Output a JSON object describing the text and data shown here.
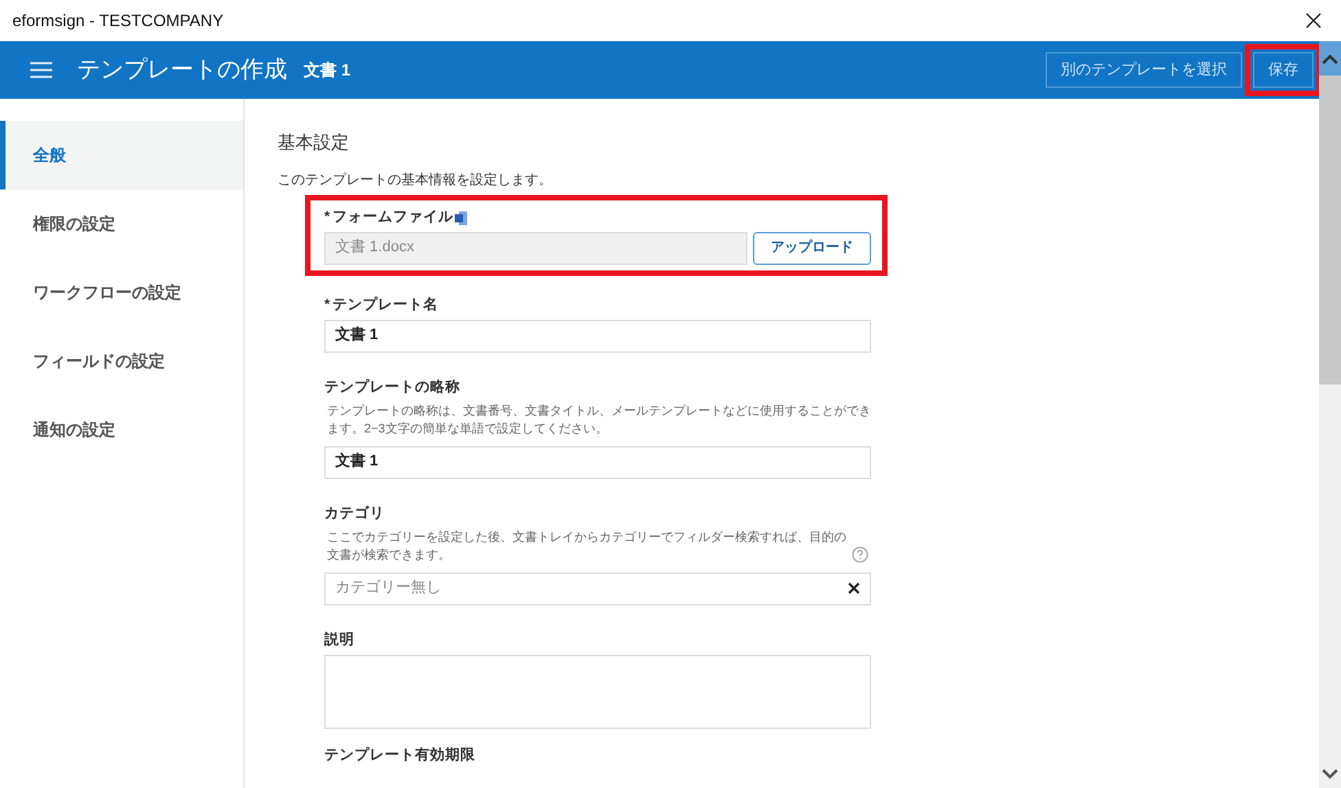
{
  "window": {
    "title": "eformsign - TESTCOMPANY"
  },
  "header": {
    "title": "テンプレートの作成",
    "document": "文書 1",
    "buttons": [
      {
        "label": "別のテンプレートを選択",
        "highlighted": false
      },
      {
        "label": "保存",
        "highlighted": true
      }
    ]
  },
  "sidebar": {
    "items": [
      {
        "label": "全般",
        "selected": true
      },
      {
        "label": "権限の設定",
        "selected": false
      },
      {
        "label": "ワークフローの設定",
        "selected": false
      },
      {
        "label": "フィールドの設定",
        "selected": false
      },
      {
        "label": "通知の設定",
        "selected": false
      }
    ]
  },
  "section": {
    "title": "基本設定",
    "description": "このテンプレートの基本情報を設定します。"
  },
  "fields": [
    {
      "kind": "file",
      "marker": "*",
      "label": "フォームファイル",
      "value": "文書 1.docx",
      "button": "アップロード",
      "highlighted": true
    },
    {
      "kind": "text",
      "marker": "*",
      "label": "テンプレート名",
      "value": "文書 1"
    },
    {
      "kind": "text",
      "label": "テンプレートの略称",
      "help": "テンプレートの略称は、文書番号、文書タイトル、メールテンプレートなどに使用することができます。2−3文字の簡単な単語で設定してください。",
      "value": "文書 1"
    },
    {
      "kind": "select",
      "label": "カテゴリ",
      "help": "ここでカテゴリーを設定した後、文書トレイからカテゴリーでフィルダー検索すれば、目的の文書が検索できます。",
      "help_icon": true,
      "placeholder": "カテゴリー無し"
    },
    {
      "kind": "textarea",
      "label": "説明"
    },
    {
      "kind": "heading",
      "label": "テンプレート有効期限"
    }
  ]
}
